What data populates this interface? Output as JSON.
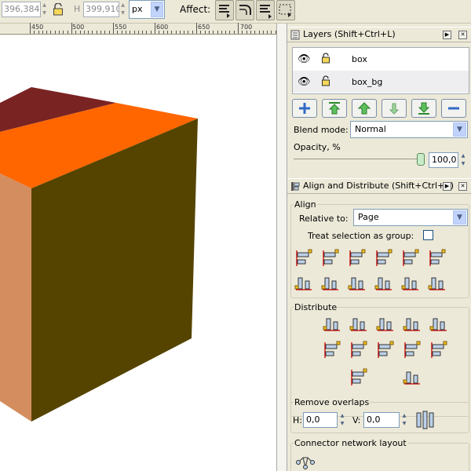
{
  "toolbar": {
    "x_value": "396,384",
    "h_label": "H",
    "h_value": "399,910",
    "unit": "px",
    "affect_label": "Affect:"
  },
  "ruler": {
    "labels": [
      "450",
      "500",
      "550",
      "600",
      "650",
      "700"
    ]
  },
  "layers_panel": {
    "title": "Layers (Shift+Ctrl+L)",
    "layers": [
      {
        "name": "box"
      },
      {
        "name": "box_bg"
      }
    ],
    "blend_mode_label": "Blend mode:",
    "blend_mode_value": "Normal",
    "opacity_label": "Opacity, %",
    "opacity_value": "100,0"
  },
  "align_panel": {
    "title": "Align and Distribute (Shift+Ctrl+A)",
    "align_legend": "Align",
    "relative_to_label": "Relative to:",
    "relative_to_value": "Page",
    "treat_group_label": "Treat selection as group:",
    "distribute_legend": "Distribute",
    "remove_overlaps_legend": "Remove overlaps",
    "h_label": "H:",
    "h_value": "0,0",
    "v_label": "V:",
    "v_value": "0,0",
    "connector_legend": "Connector network layout"
  },
  "colors": {
    "cube_top_dark": "#7a2323",
    "cube_top_orange": "#ff6600",
    "cube_front": "#d38d5f",
    "cube_side": "#554400",
    "accent_blue": "#316ac5"
  }
}
